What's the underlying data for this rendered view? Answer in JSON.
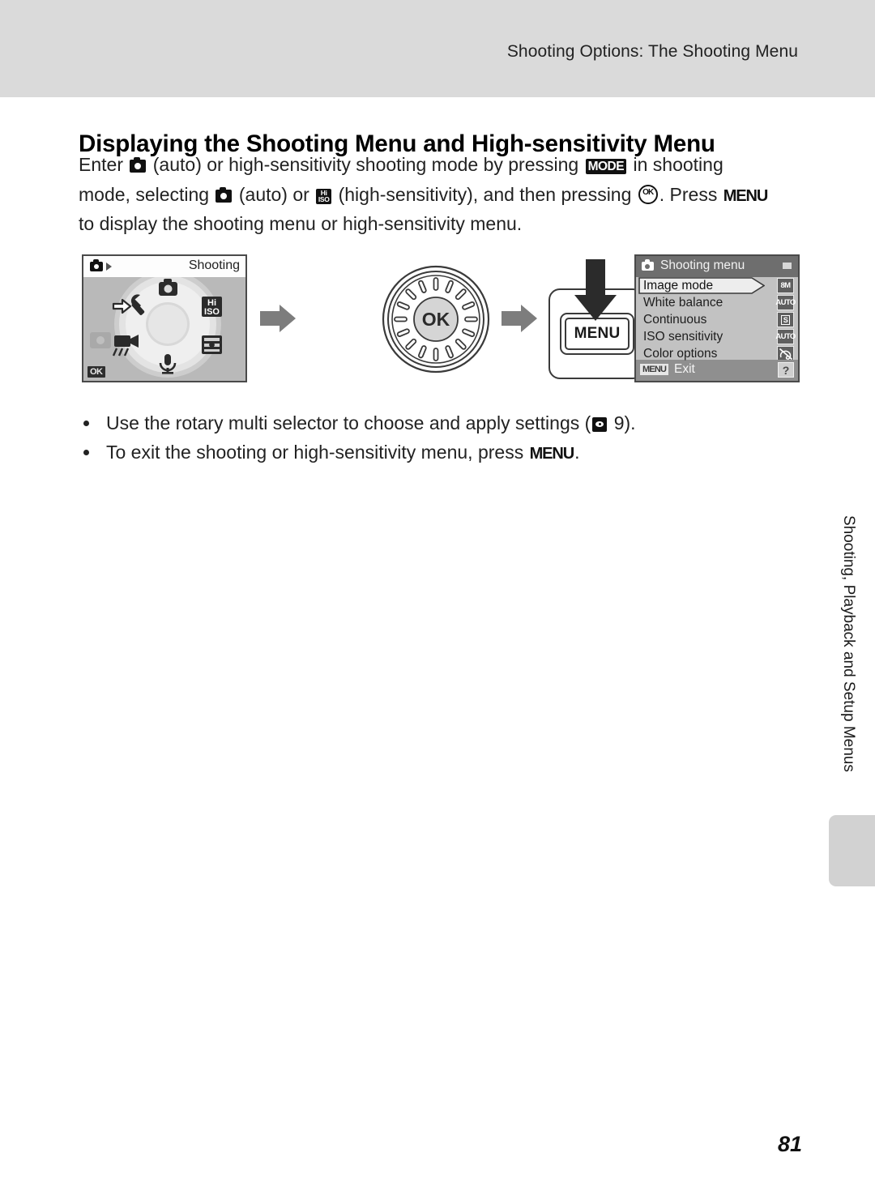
{
  "header": {
    "running_title": "Shooting Options: The Shooting Menu"
  },
  "heading": "Displaying the Shooting Menu and High-sensitivity Menu",
  "intro": {
    "line1_a": "Enter",
    "line1_b": "(auto) or high-sensitivity shooting mode by pressing",
    "line1_mode_icon": "MODE",
    "line1_c": "in shooting",
    "line2_a": "mode, selecting",
    "line2_b": "(auto) or",
    "line2_hiso_top": "Hi",
    "line2_hiso_bottom": "ISO",
    "line2_c": "(high-sensitivity), and then pressing",
    "line2_ok_icon": "OK",
    "line2_d": ". Press",
    "line2_menu_icon": "MENU",
    "line3": "to display the shooting menu or high-sensitivity menu."
  },
  "figure": {
    "mode_screen": {
      "top_label": "Shooting",
      "ok_badge": "OK",
      "dial_icons": [
        "camera-icon",
        "hi-iso-icon",
        "scene-mode-icon",
        "microphone-icon",
        "movie-icon",
        "setup-wrench-icon"
      ],
      "hiso_top": "Hi",
      "hiso_bottom": "ISO"
    },
    "rotary_selector": {
      "center_label": "OK",
      "tick_count": 16
    },
    "menu_button": {
      "label": "MENU"
    },
    "shooting_menu": {
      "title": "Shooting menu",
      "items": [
        {
          "label": "Image mode",
          "badge": "8M",
          "badge_style": "text",
          "selected": true
        },
        {
          "label": "White balance",
          "badge": "AUTO",
          "badge_style": "text",
          "selected": false
        },
        {
          "label": "Continuous",
          "badge": "S",
          "badge_style": "boxed",
          "selected": false
        },
        {
          "label": "ISO sensitivity",
          "badge": "AUTO",
          "badge_style": "text",
          "selected": false
        },
        {
          "label": "Color options",
          "badge": "",
          "badge_style": "cross",
          "selected": false
        }
      ],
      "bottom_menu_badge": "MENU",
      "bottom_exit_label": "Exit",
      "help_label": "?"
    }
  },
  "bullets": {
    "b1_a": "Use the rotary multi selector to choose and apply settings (",
    "b1_ref": "9).",
    "b2_a": "To exit the shooting or high-sensitivity menu, press",
    "b2_menu_icon": "MENU",
    "b2_end": "."
  },
  "side_tab": {
    "label": "Shooting, Playback and Setup Menus"
  },
  "page_number": "81",
  "colors": {
    "header_band": "#dadada",
    "lcd_border": "#4a4a4a",
    "menu_titlebar": "#6e6e6e",
    "menu_body": "#c2c2c2",
    "menu_bottombar": "#8f8f8f",
    "arrow_gray": "#7d7d7d",
    "side_tab": "#d2d2d2"
  }
}
